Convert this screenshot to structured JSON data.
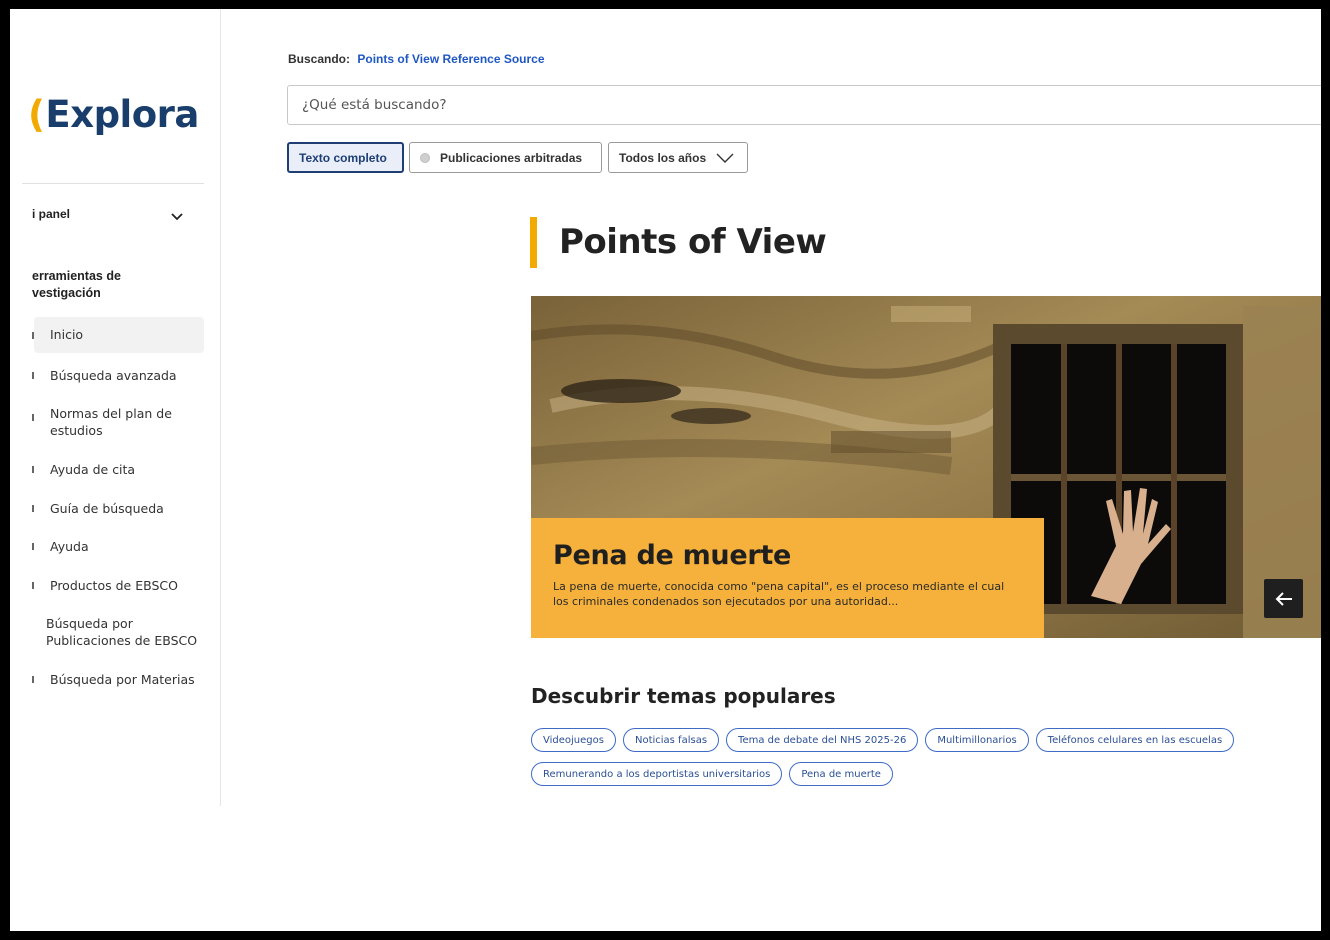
{
  "sidebar": {
    "logo": "Explora",
    "panel_label": "i panel",
    "tools_heading_line1": "erramientas de",
    "tools_heading_line2": "vestigación",
    "items": [
      {
        "label": "Inicio"
      },
      {
        "label": "Búsqueda avanzada"
      },
      {
        "label": "Normas del plan de estudios"
      },
      {
        "label": "Ayuda de cita"
      },
      {
        "label": "Guía de búsqueda"
      },
      {
        "label": "Ayuda"
      },
      {
        "label": "Productos de EBSCO"
      },
      {
        "label": "Búsqueda por Publicaciones de EBSCO"
      },
      {
        "label": "Búsqueda por Materias"
      }
    ]
  },
  "search": {
    "searching_label": "Buscando:",
    "source": "Points of View Reference Source",
    "placeholder": "¿Qué está buscando?"
  },
  "filters": {
    "full_text": "Texto completo",
    "peer_reviewed": "Publicaciones arbitradas",
    "years": "Todos los años"
  },
  "main": {
    "title": "Points of View",
    "hero": {
      "title": "Pena de muerte",
      "description": "La pena de muerte, conocida como \"pena capital\", es el proceso mediante el cual los criminales condenados son ejecutados por una autoridad..."
    },
    "discover_heading": "Descubrir temas populares",
    "topics_row1": [
      "Videojuegos",
      "Noticias falsas",
      "Tema de debate del NHS 2025-26",
      "Multimillonarios",
      "Teléfonos celulares en las escuelas"
    ],
    "topics_row2": [
      "Remunerando a los deportistas universitarios",
      "Pena de muerte"
    ]
  },
  "colors": {
    "accent": "#f2a900",
    "hero_card": "#f5b13b",
    "link": "#1f57c3",
    "chip_border": "#3d6bc6"
  }
}
